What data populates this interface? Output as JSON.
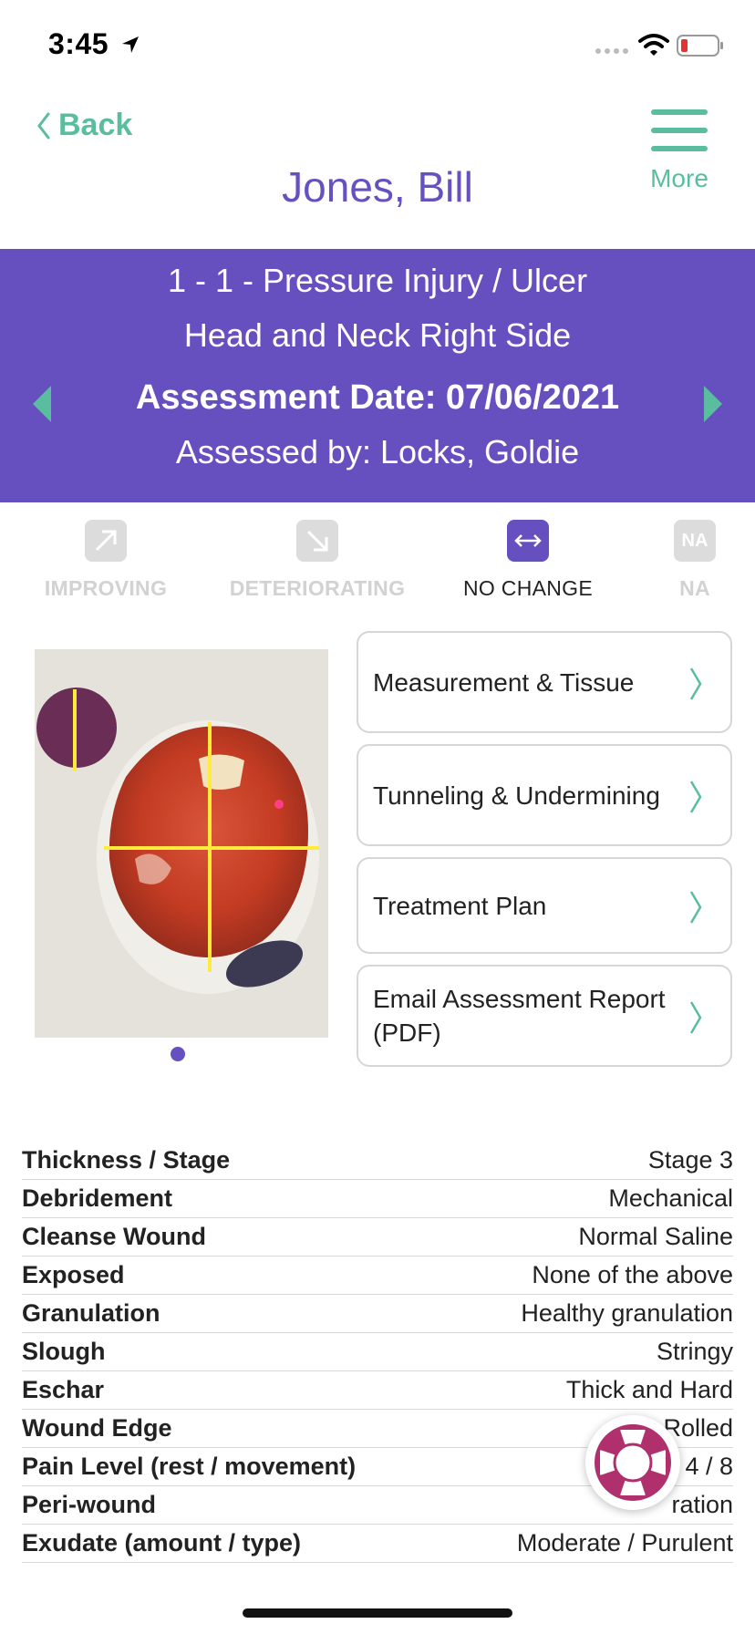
{
  "status_bar": {
    "time": "3:45"
  },
  "nav": {
    "back_label": "Back",
    "more_label": "More",
    "patient_name": "Jones, Bill"
  },
  "wound": {
    "title": "1 - 1  - Pressure Injury / Ulcer",
    "location": "Head and Neck Right Side",
    "assessment_date": "Assessment Date: 07/06/2021",
    "assessed_by": "Assessed by: Locks, Goldie"
  },
  "trend": {
    "improving": "IMPROVING",
    "deteriorating": "DETERIORATING",
    "no_change": "NO CHANGE",
    "na_icon": "NA",
    "na": "NA",
    "selected": "no_change"
  },
  "actions": {
    "measurement": "Measurement & Tissue",
    "tunneling": "Tunneling & Undermining",
    "treatment": "Treatment Plan",
    "email": "Email Assessment Report (PDF)"
  },
  "details": {
    "rows": [
      {
        "label": "Thickness / Stage",
        "value": "Stage 3"
      },
      {
        "label": "Debridement",
        "value": "Mechanical"
      },
      {
        "label": "Cleanse Wound",
        "value": "Normal Saline"
      },
      {
        "label": "Exposed",
        "value": "None of the above"
      },
      {
        "label": "Granulation",
        "value": "Healthy granulation"
      },
      {
        "label": "Slough",
        "value": "Stringy"
      },
      {
        "label": "Eschar",
        "value": "Thick and Hard"
      },
      {
        "label": "Wound Edge",
        "value": "Rolled"
      },
      {
        "label": "Pain Level (rest / movement)",
        "value": "4 / 8"
      },
      {
        "label": "Peri-wound",
        "value": "ration"
      },
      {
        "label": "Exudate (amount / type)",
        "value": "Moderate / Purulent"
      }
    ]
  },
  "colors": {
    "accent_green": "#5bbd9f",
    "brand_purple": "#6650bf",
    "help_magenta": "#b0306e"
  }
}
